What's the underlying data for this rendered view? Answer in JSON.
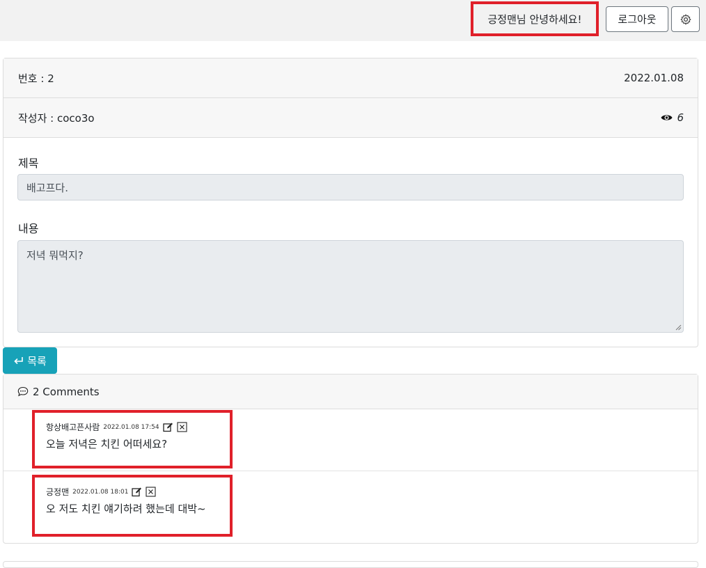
{
  "header": {
    "greeting": "긍정맨님 안녕하세요!",
    "logout_label": "로그아웃",
    "settings_icon": "gear-icon"
  },
  "post": {
    "number_label": "번호 : 2",
    "date": "2022.01.08",
    "author_label": "작성자 : coco3o",
    "views": "6",
    "title_label": "제목",
    "title_value": "배고프다.",
    "content_label": "내용",
    "content_value": "저녁 뭐먹지?"
  },
  "actions": {
    "list_label": "목록"
  },
  "comments": {
    "header": "2 Comments",
    "items": [
      {
        "author": "항상배고픈사람",
        "date": "2022.01.08 17:54",
        "text": "오늘 저녁은 치킨 어떠세요?"
      },
      {
        "author": "긍정맨",
        "date": "2022.01.08 18:01",
        "text": "오 저도 치킨 얘기하려 했는데 대박~"
      }
    ]
  },
  "colors": {
    "accent": "#17a2b8",
    "highlight": "#e0202a"
  }
}
